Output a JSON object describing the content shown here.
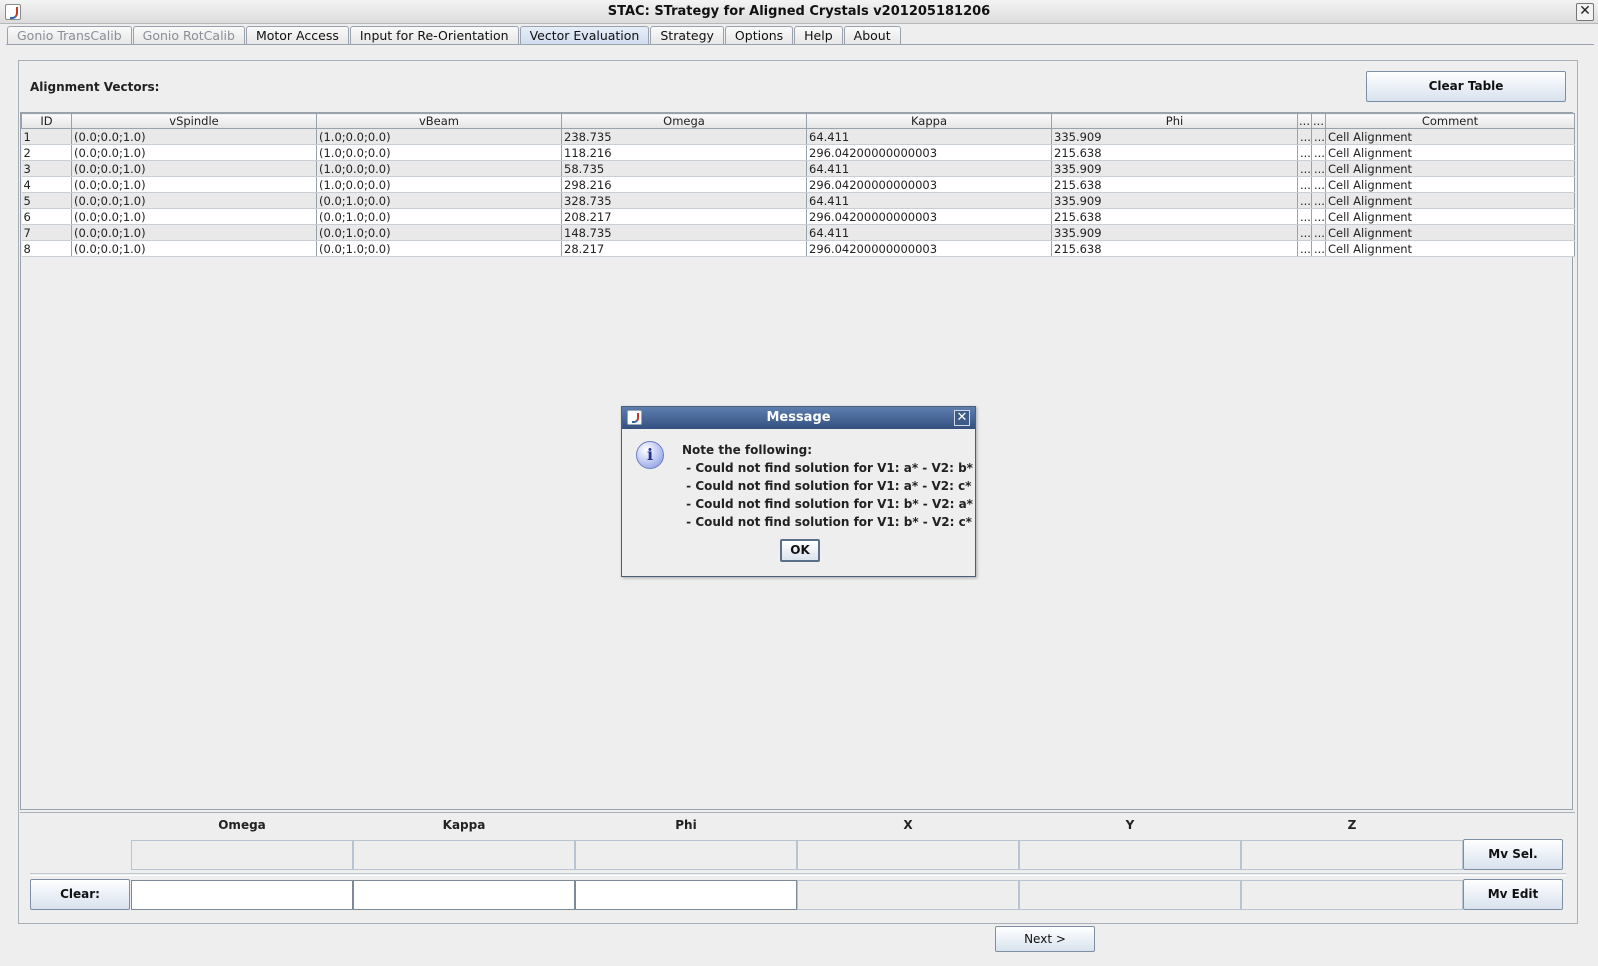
{
  "window": {
    "title": "STAC: STrategy for Aligned Crystals v201205181206"
  },
  "tabs": [
    {
      "label": "Gonio TransCalib",
      "state": "disabled"
    },
    {
      "label": "Gonio RotCalib",
      "state": "disabled"
    },
    {
      "label": "Motor Access",
      "state": "normal"
    },
    {
      "label": "Input for Re-Orientation",
      "state": "normal"
    },
    {
      "label": "Vector Evaluation",
      "state": "active"
    },
    {
      "label": "Strategy",
      "state": "normal"
    },
    {
      "label": "Options",
      "state": "normal"
    },
    {
      "label": "Help",
      "state": "normal"
    },
    {
      "label": "About",
      "state": "normal"
    }
  ],
  "main": {
    "alignment_label": "Alignment Vectors:",
    "clear_table_label": "Clear Table"
  },
  "table": {
    "columns": [
      "ID",
      "vSpindle",
      "vBeam",
      "Omega",
      "Kappa",
      "Phi",
      "...",
      "...",
      "Comment"
    ],
    "rows": [
      [
        "1",
        "(0.0;0.0;1.0)",
        "(1.0;0.0;0.0)",
        "238.735",
        "64.411",
        "335.909",
        "...",
        "...",
        "Cell Alignment"
      ],
      [
        "2",
        "(0.0;0.0;1.0)",
        "(1.0;0.0;0.0)",
        "118.216",
        "296.04200000000003",
        "215.638",
        "...",
        "...",
        "Cell Alignment"
      ],
      [
        "3",
        "(0.0;0.0;1.0)",
        "(1.0;0.0;0.0)",
        "58.735",
        "64.411",
        "335.909",
        "...",
        "...",
        "Cell Alignment"
      ],
      [
        "4",
        "(0.0;0.0;1.0)",
        "(1.0;0.0;0.0)",
        "298.216",
        "296.04200000000003",
        "215.638",
        "...",
        "...",
        "Cell Alignment"
      ],
      [
        "5",
        "(0.0;0.0;1.0)",
        "(0.0;1.0;0.0)",
        "328.735",
        "64.411",
        "335.909",
        "...",
        "...",
        "Cell Alignment"
      ],
      [
        "6",
        "(0.0;0.0;1.0)",
        "(0.0;1.0;0.0)",
        "208.217",
        "296.04200000000003",
        "215.638",
        "...",
        "...",
        "Cell Alignment"
      ],
      [
        "7",
        "(0.0;0.0;1.0)",
        "(0.0;1.0;0.0)",
        "148.735",
        "64.411",
        "335.909",
        "...",
        "...",
        "Cell Alignment"
      ],
      [
        "8",
        "(0.0;0.0;1.0)",
        "(0.0;1.0;0.0)",
        "28.217",
        "296.04200000000003",
        "215.638",
        "...",
        "...",
        "Cell Alignment"
      ]
    ]
  },
  "bottom": {
    "headers": [
      "Omega",
      "Kappa",
      "Phi",
      "X",
      "Y",
      "Z"
    ],
    "mv_sel_label": "Mv Sel.",
    "mv_edit_label": "Mv Edit",
    "clear_label": "Clear:",
    "next_label": "Next >"
  },
  "dialog": {
    "title": "Message",
    "icon": "info-icon",
    "lines": [
      "Note the following:",
      " - Could not find solution for V1: a* - V2: b*",
      " - Could not find solution for V1: a* - V2: c*",
      " - Could not find solution for V1: b* - V2: a*",
      " - Could not find solution for V1: b* - V2: c*"
    ],
    "ok_label": "OK"
  }
}
